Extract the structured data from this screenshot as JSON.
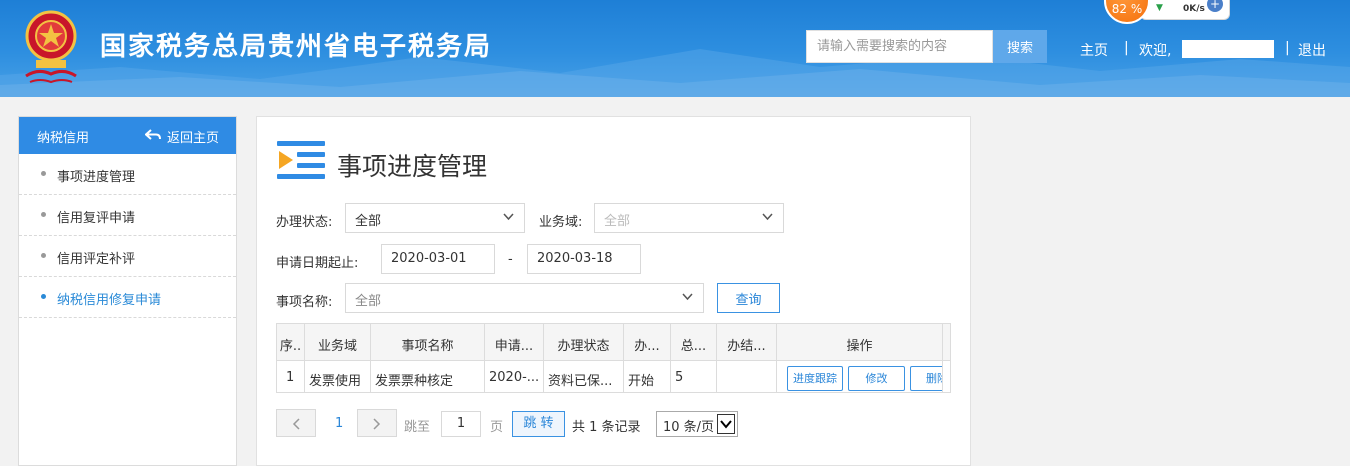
{
  "header": {
    "site_title": "国家税务总局贵州省电子税务局",
    "search_placeholder": "请输入需要搜索的内容",
    "search_button": "搜索",
    "nav_home": "主页",
    "nav_separator": "|",
    "nav_welcome": "欢迎,",
    "nav_logout": "退出",
    "net_widget": {
      "percent": "82 %",
      "speed": "0K/s"
    }
  },
  "sidebar": {
    "title": "纳税信用",
    "back_label": "返回主页",
    "items": [
      {
        "label": "事项进度管理",
        "active": false
      },
      {
        "label": "信用复评申请",
        "active": false
      },
      {
        "label": "信用评定补评",
        "active": false
      },
      {
        "label": "纳税信用修复申请",
        "active": true
      }
    ]
  },
  "main": {
    "title": "事项进度管理",
    "filters": {
      "status_label": "办理状态:",
      "status_value": "全部",
      "domain_label": "业务域:",
      "domain_value": "全部",
      "date_label": "申请日期起止:",
      "date_start": "2020-03-01",
      "date_sep": "-",
      "date_end": "2020-03-18",
      "item_name_label": "事项名称:",
      "item_name_value": "全部",
      "query_button": "查询"
    },
    "table": {
      "headers": [
        "序..",
        "业务域",
        "事项名称",
        "申请...",
        "办理状态",
        "办...",
        "总...",
        "办结...",
        "操作"
      ],
      "rows": [
        {
          "cells": [
            "1",
            "发票使用",
            "发票票种核定",
            "2020-...",
            "资料已保...",
            "开始",
            "5",
            ""
          ],
          "actions": [
            "进度跟踪",
            "修改",
            "删除"
          ]
        }
      ]
    },
    "pagination": {
      "current_page": "1",
      "jump_to_label": "跳至",
      "jump_page_value": "1",
      "page_unit": "页",
      "jump_button": "跳 转",
      "total_text": "共 1 条记录",
      "page_size": "10 条/页"
    }
  },
  "colors": {
    "header_blue": "#2e8fe0",
    "accent_blue": "#2f8be4",
    "link_blue": "#2a86d8",
    "icon_orange": "#f5a623"
  }
}
